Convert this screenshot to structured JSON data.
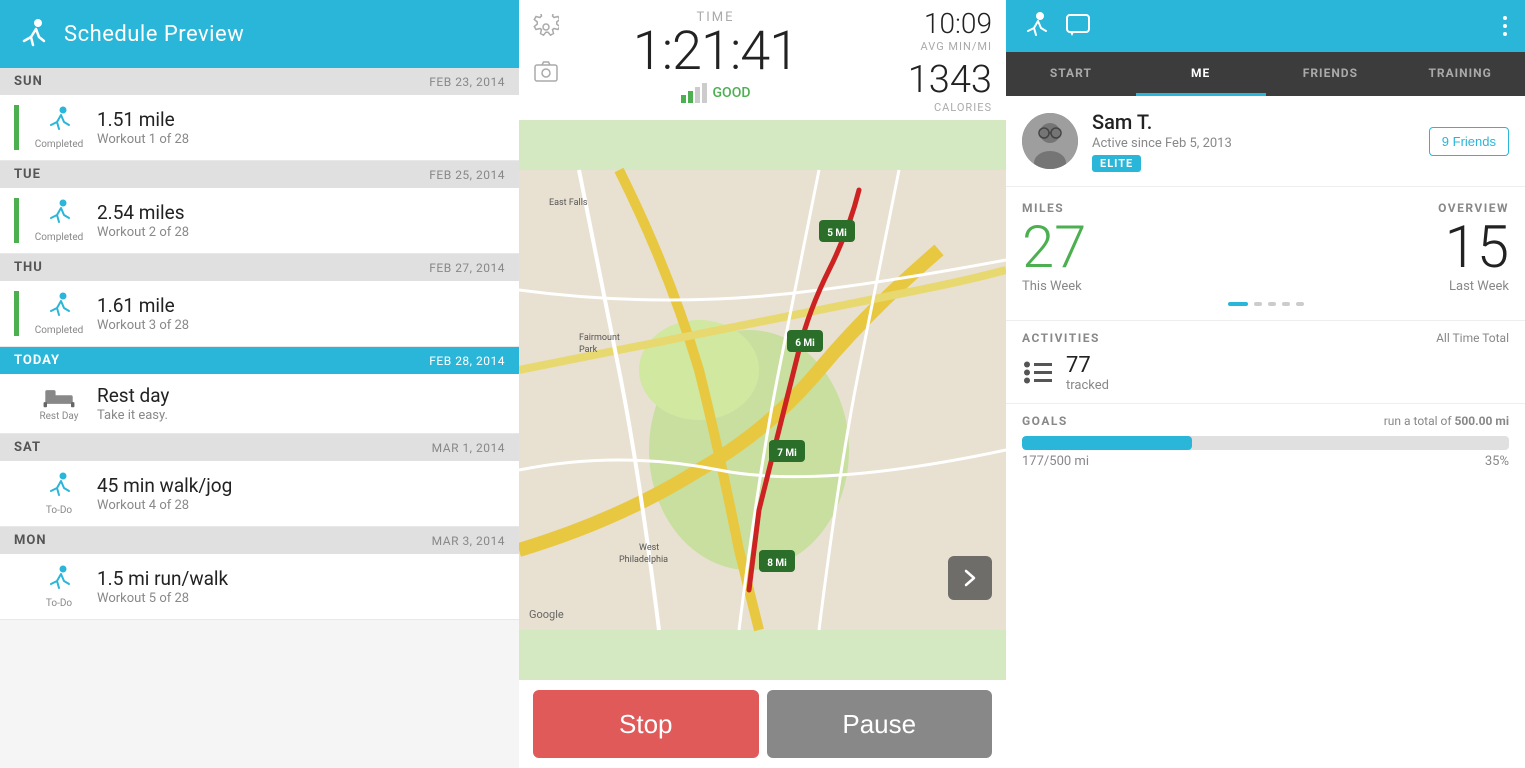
{
  "left": {
    "header": {
      "title": "Schedule Preview",
      "icon": "runner"
    },
    "schedule": [
      {
        "day": "SUN",
        "date": "FEB 23, 2014",
        "type": "run",
        "status": "Completed",
        "title": "1.51 mile",
        "subtitle": "Workout 1 of 28"
      },
      {
        "day": "TUE",
        "date": "FEB 25, 2014",
        "type": "run",
        "status": "Completed",
        "title": "2.54 miles",
        "subtitle": "Workout 2 of 28"
      },
      {
        "day": "THU",
        "date": "FEB 27, 2014",
        "type": "run",
        "status": "Completed",
        "title": "1.61 mile",
        "subtitle": "Workout 3 of 28"
      },
      {
        "day": "TODAY",
        "date": "FEB 28, 2014",
        "type": "rest",
        "status": "Rest Day",
        "title": "Rest day",
        "subtitle": "Take it easy.",
        "isToday": true
      },
      {
        "day": "SAT",
        "date": "MAR 1, 2014",
        "type": "run",
        "status": "To-Do",
        "title": "45 min walk/jog",
        "subtitle": "Workout 4 of 28"
      },
      {
        "day": "MON",
        "date": "MAR 3, 2014",
        "type": "run",
        "status": "To-Do",
        "title": "1.5 mi run/walk",
        "subtitle": "Workout 5 of 28"
      }
    ]
  },
  "middle": {
    "time_label": "TIME",
    "time_value": "1:21:41",
    "avg_value": "10:09",
    "avg_label": "AVG MIN/MI",
    "calories_value": "1343",
    "calories_label": "CALORIES",
    "signal_text": "GOOD",
    "stop_label": "Stop",
    "pause_label": "Pause"
  },
  "right": {
    "tabs": [
      "START",
      "ME",
      "FRIENDS",
      "TRAINING"
    ],
    "active_tab": "ME",
    "profile": {
      "name": "Sam T.",
      "since": "Active since Feb 5, 2013",
      "badge": "ELITE",
      "friends_label": "9 Friends"
    },
    "miles": {
      "label": "MILES",
      "overview_label": "OVERVIEW",
      "this_week_value": "27",
      "this_week_label": "This Week",
      "last_week_value": "15",
      "last_week_label": "Last Week"
    },
    "activities": {
      "label": "ACTIVITIES",
      "right_label": "All Time Total",
      "count": "77",
      "sub": "tracked"
    },
    "goals": {
      "label": "GOALS",
      "description": "run a total of",
      "goal_amount": "500.00 mi",
      "progress_start": "177/500 mi",
      "progress_pct": "35%",
      "fill_pct": 35
    }
  }
}
